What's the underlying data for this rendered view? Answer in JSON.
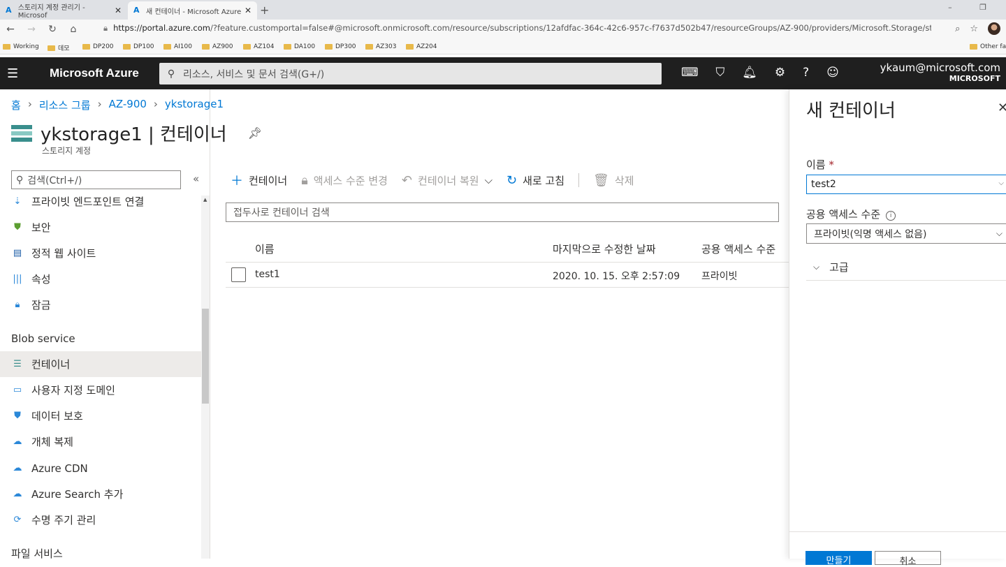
{
  "browser": {
    "tabs": [
      {
        "label": "스토리지 계정 관리기 - Microsof"
      },
      {
        "label": "새 컨테이너 - Microsoft Azure"
      }
    ],
    "url_prefix": "https://portal.azure.com",
    "url_rest": "/?feature.customportal=false#@microsoft.onmicrosoft.com/resource/subscriptions/12afdfac-364c-42c6-957c-f7637d502b47/resourceGroups/AZ-900/providers/Microsoft.Storage/storage...",
    "bookmarks": [
      "Working",
      "데모",
      "DP200",
      "DP100",
      "AI100",
      "AZ900",
      "AZ104",
      "DA100",
      "DP300",
      "AZ303",
      "AZ204"
    ],
    "other_favorites": "Other fa"
  },
  "header": {
    "brand": "Microsoft Azure",
    "search_placeholder": "리소스, 서비스 및 문서 검색(G+/)",
    "user_email": "ykaum@microsoft.com",
    "user_org": "MICROSOFT"
  },
  "breadcrumb": [
    "홈",
    "리소스 그룹",
    "AZ-900",
    "ykstorage1"
  ],
  "page": {
    "title": "ykstorage1 | 컨테이너",
    "subtitle": "스토리지 계정"
  },
  "sidebar": {
    "search_placeholder": "검색(Ctrl+/)",
    "items_top": [
      {
        "label": "프라이빗 엔드포인트 연결",
        "icon": "endpoint-icon"
      },
      {
        "label": "보안",
        "icon": "shield-icon"
      },
      {
        "label": "정적 웹 사이트",
        "icon": "website-icon"
      },
      {
        "label": "속성",
        "icon": "properties-icon"
      },
      {
        "label": "잠금",
        "icon": "lock-icon"
      }
    ],
    "group_blob": "Blob service",
    "items_blob": [
      {
        "label": "컨테이너",
        "icon": "container-icon"
      },
      {
        "label": "사용자 지정 도메인",
        "icon": "domain-icon"
      },
      {
        "label": "데이터 보호",
        "icon": "data-protection-icon"
      },
      {
        "label": "개체 복제",
        "icon": "replication-icon"
      },
      {
        "label": "Azure CDN",
        "icon": "cdn-icon"
      },
      {
        "label": "Azure Search 추가",
        "icon": "search-add-icon"
      },
      {
        "label": "수명 주기 관리",
        "icon": "lifecycle-icon"
      }
    ],
    "group_file": "파일 서비스"
  },
  "toolbar": {
    "add": "컨테이너",
    "access_level": "액세스 수준 변경",
    "restore": "컨테이너 복원",
    "refresh": "새로 고침",
    "delete": "삭제"
  },
  "filter_placeholder": "접두사로 컨테이너 검색",
  "table": {
    "columns": [
      "이름",
      "마지막으로 수정한 날짜",
      "공용 액세스 수준"
    ],
    "rows": [
      {
        "name": "test1",
        "modified": "2020. 10. 15. 오후 2:57:09",
        "access": "프라이빗"
      }
    ]
  },
  "panel": {
    "title": "새 컨테이너",
    "name_label": "이름",
    "name_value": "test2",
    "access_label": "공용 액세스 수준",
    "access_value": "프라이빗(익명 액세스 없음)",
    "advanced": "고급",
    "create": "만들기",
    "cancel": "취소"
  },
  "colors": {
    "accent": "#0078d4",
    "header_bg": "#1f1f1f",
    "selected_bg": "#edebe9"
  }
}
